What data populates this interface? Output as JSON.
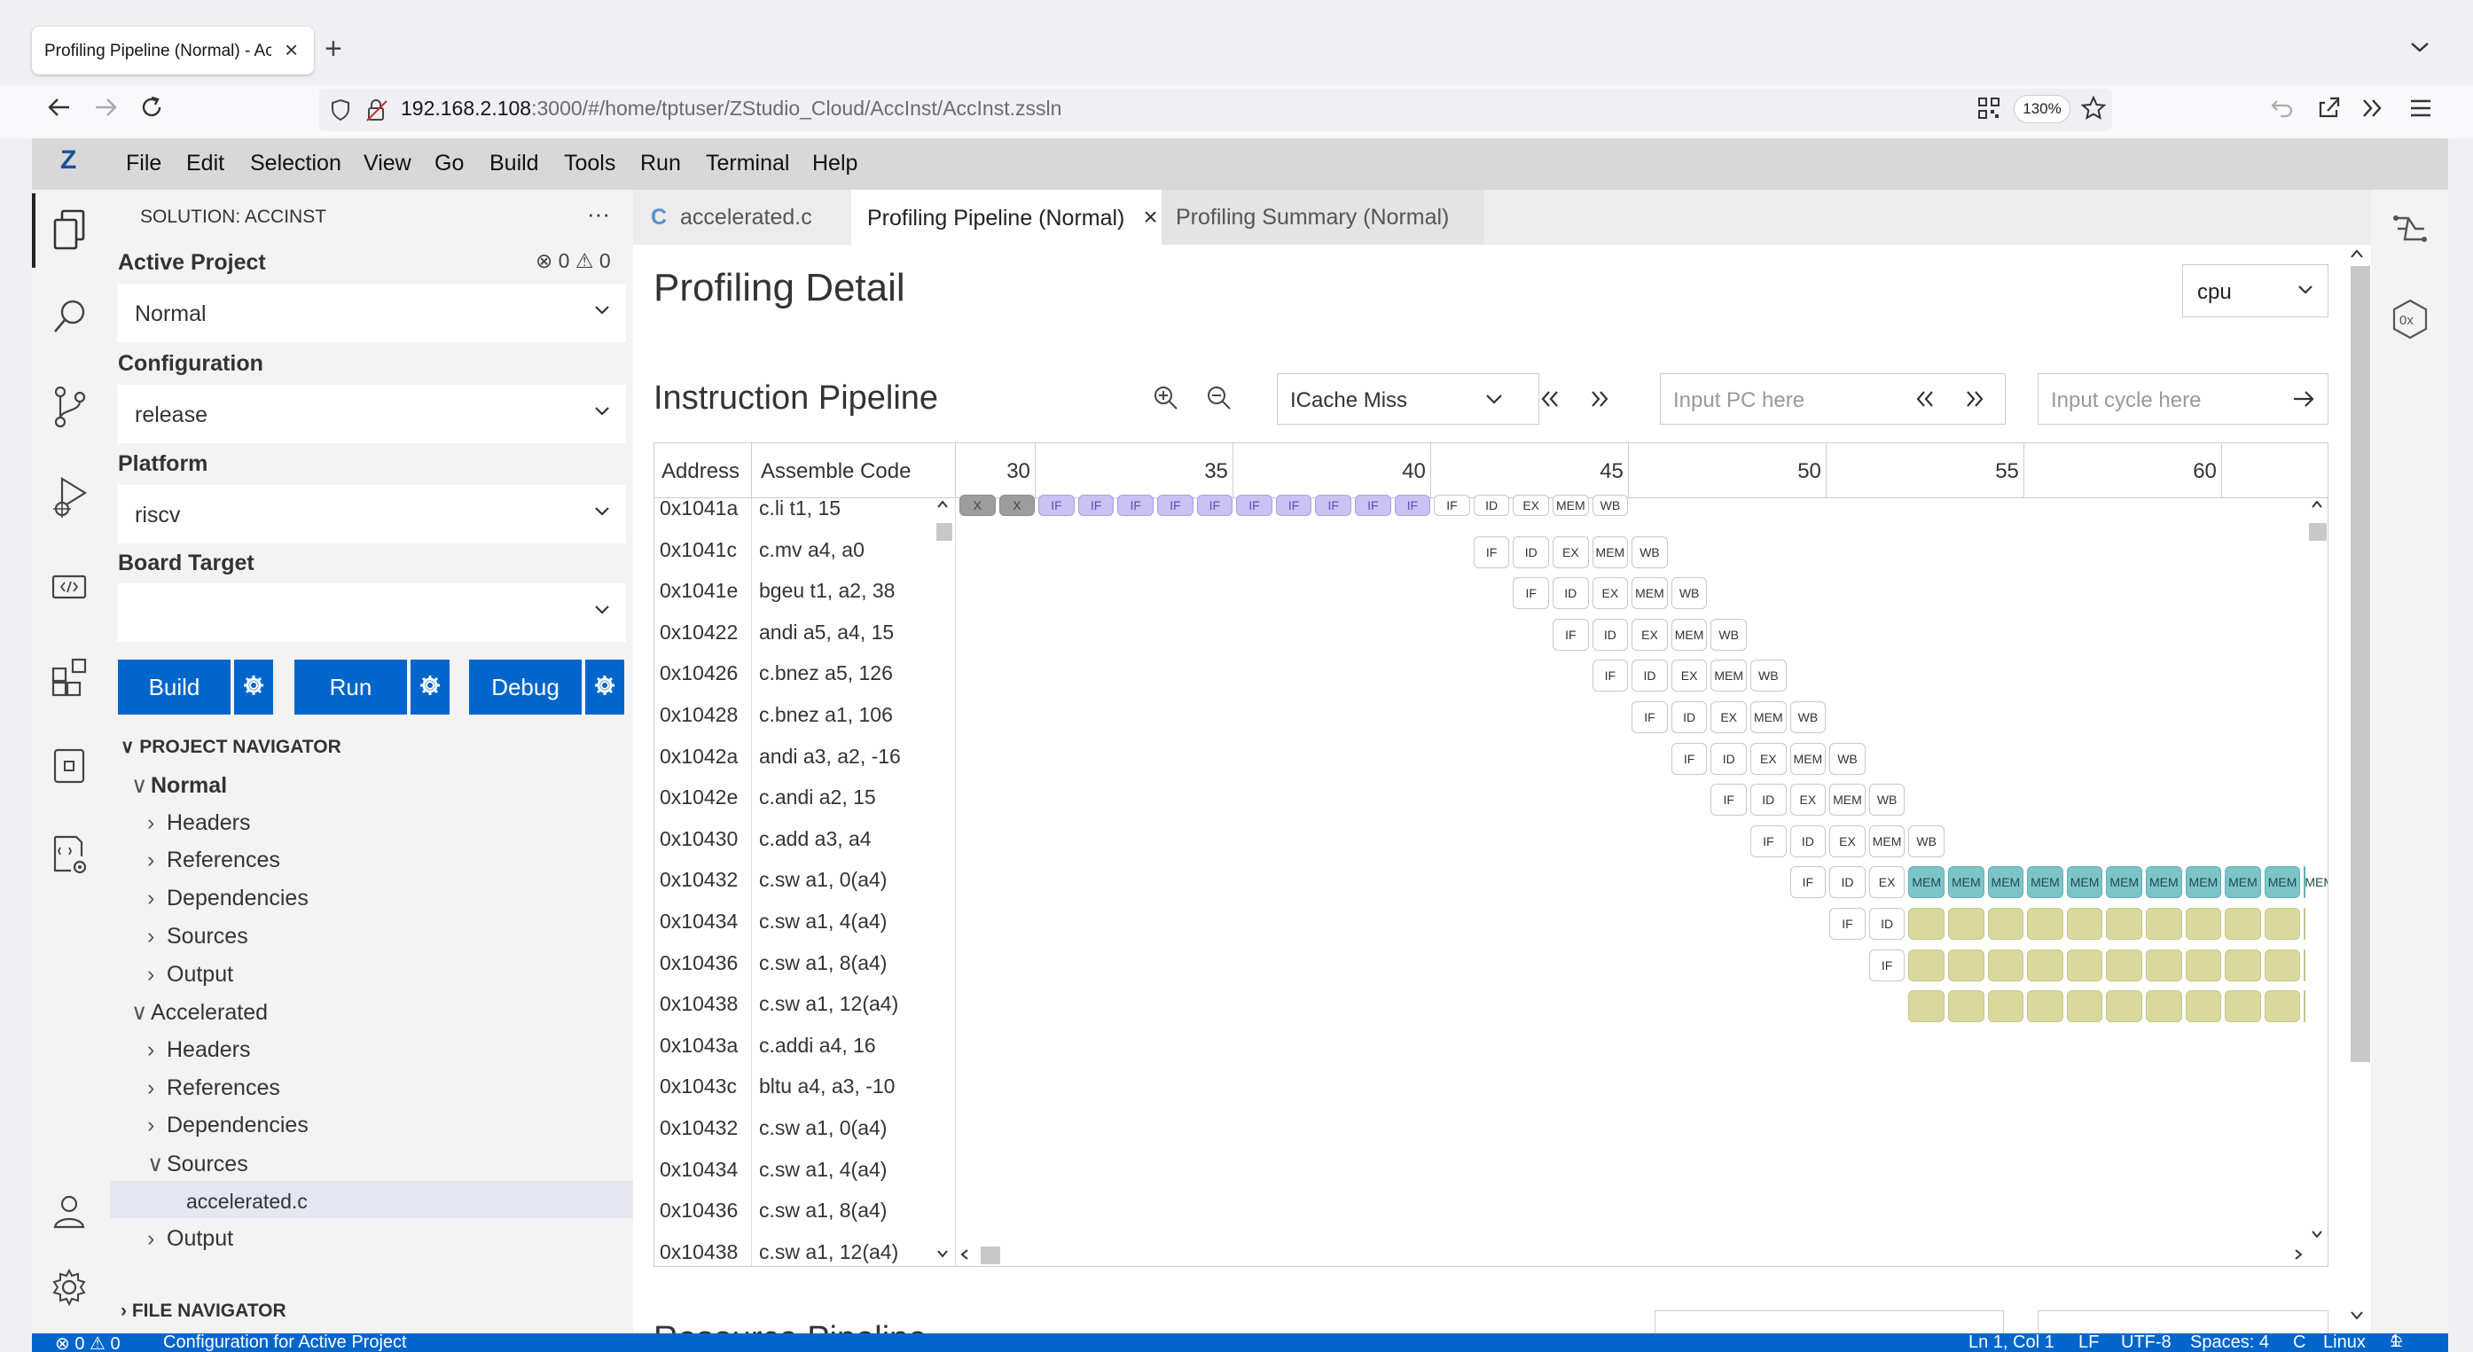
{
  "browser": {
    "tab_title": "Profiling Pipeline (Normal) - AccInst",
    "url_host": "192.168.2.108",
    "url_path": ":3000/#/home/tptuser/ZStudio_Cloud/AccInst/AccInst.zssln",
    "zoom": "130%"
  },
  "app": {
    "logo": "Z",
    "menu": [
      "File",
      "Edit",
      "Selection",
      "View",
      "Go",
      "Build",
      "Tools",
      "Run",
      "Terminal",
      "Help"
    ]
  },
  "sidebar": {
    "solution_title": "SOLUTION: ACCINST",
    "more": "···",
    "active_project_label": "Active Project",
    "problems_errors": "0",
    "problems_warnings": "0",
    "active_project_value": "Normal",
    "configuration_label": "Configuration",
    "configuration_value": "release",
    "platform_label": "Platform",
    "platform_value": "riscv",
    "board_target_label": "Board Target",
    "board_target_value": "",
    "build_label": "Build",
    "run_label": "Run",
    "debug_label": "Debug",
    "project_navigator": "PROJECT NAVIGATOR",
    "file_navigator": "FILE NAVIGATOR",
    "tree": [
      {
        "label": "Normal",
        "level": 0,
        "expanded": true
      },
      {
        "label": "Headers",
        "level": 1,
        "expanded": false
      },
      {
        "label": "References",
        "level": 1,
        "expanded": false
      },
      {
        "label": "Dependencies",
        "level": 1,
        "expanded": false
      },
      {
        "label": "Sources",
        "level": 1,
        "expanded": false
      },
      {
        "label": "Output",
        "level": 1,
        "expanded": false
      },
      {
        "label": "Accelerated",
        "level": 0,
        "expanded": true
      },
      {
        "label": "Headers",
        "level": 1,
        "expanded": false
      },
      {
        "label": "References",
        "level": 1,
        "expanded": false
      },
      {
        "label": "Dependencies",
        "level": 1,
        "expanded": false
      },
      {
        "label": "Sources",
        "level": 1,
        "expanded": true
      },
      {
        "label": "accelerated.c",
        "level": 2,
        "selected": true
      },
      {
        "label": "Output",
        "level": 1,
        "expanded": false
      }
    ]
  },
  "editor": {
    "tabs": [
      {
        "label": "accelerated.c",
        "icon": "C",
        "active": false
      },
      {
        "label": "Profiling Pipeline (Normal)",
        "active": true
      },
      {
        "label": "Profiling Summary (Normal)",
        "active": false
      }
    ]
  },
  "profiling": {
    "title": "Profiling Detail",
    "cpu_select": "cpu",
    "pipeline_title": "Instruction Pipeline",
    "event_filter": "ICache Miss",
    "pc_placeholder": "Input PC here",
    "cycle_placeholder": "Input cycle here",
    "col_address": "Address",
    "col_asm": "Assemble Code",
    "cycle_ticks": [
      "30",
      "35",
      "40",
      "45",
      "50",
      "55",
      "60"
    ],
    "first_cycle": 29,
    "rows": [
      {
        "addr": "0x1041a",
        "asm": "c.li t1, 15"
      },
      {
        "addr": "0x1041c",
        "asm": "c.mv a4, a0"
      },
      {
        "addr": "0x1041e",
        "asm": "bgeu t1, a2, 38"
      },
      {
        "addr": "0x10422",
        "asm": "andi a5, a4, 15"
      },
      {
        "addr": "0x10426",
        "asm": "c.bnez a5, 126"
      },
      {
        "addr": "0x10428",
        "asm": "c.bnez a1, 106"
      },
      {
        "addr": "0x1042a",
        "asm": "andi a3, a2, -16"
      },
      {
        "addr": "0x1042e",
        "asm": "c.andi a2, 15"
      },
      {
        "addr": "0x10430",
        "asm": "c.add a3, a4"
      },
      {
        "addr": "0x10432",
        "asm": "c.sw a1, 0(a4)"
      },
      {
        "addr": "0x10434",
        "asm": "c.sw a1, 4(a4)"
      },
      {
        "addr": "0x10436",
        "asm": "c.sw a1, 8(a4)"
      },
      {
        "addr": "0x10438",
        "asm": "c.sw a1, 12(a4)"
      },
      {
        "addr": "0x1043a",
        "asm": "c.addi a4, 16"
      },
      {
        "addr": "0x1043c",
        "asm": "bltu a4, a3, -10"
      },
      {
        "addr": "0x10432",
        "asm": "c.sw a1, 0(a4)"
      },
      {
        "addr": "0x10434",
        "asm": "c.sw a1, 4(a4)"
      },
      {
        "addr": "0x10436",
        "asm": "c.sw a1, 8(a4)"
      },
      {
        "addr": "0x10438",
        "asm": "c.sw a1, 12(a4)"
      }
    ],
    "pipeline": [
      {
        "row": 0,
        "stages": [
          "X",
          "X",
          "IF",
          "IF",
          "IF",
          "IF",
          "IF",
          "IF",
          "IF",
          "IF",
          "IF",
          "IF",
          "IF",
          "ID",
          "EX",
          "MEM",
          "WB"
        ],
        "kinds": [
          "stall",
          "stall",
          "if-miss",
          "if-miss",
          "if-miss",
          "if-miss",
          "if-miss",
          "if-miss",
          "if-miss",
          "if-miss",
          "if-miss",
          "if-miss",
          "normal",
          "normal",
          "normal",
          "normal",
          "normal"
        ],
        "start": 29
      },
      {
        "row": 1,
        "stages": [
          "IF",
          "ID",
          "EX",
          "MEM",
          "WB"
        ],
        "start": 42
      },
      {
        "row": 2,
        "stages": [
          "IF",
          "ID",
          "EX",
          "MEM",
          "WB"
        ],
        "start": 43
      },
      {
        "row": 3,
        "stages": [
          "IF",
          "ID",
          "EX",
          "MEM",
          "WB"
        ],
        "start": 44
      },
      {
        "row": 4,
        "stages": [
          "IF",
          "ID",
          "EX",
          "MEM",
          "WB"
        ],
        "start": 45
      },
      {
        "row": 5,
        "stages": [
          "IF",
          "ID",
          "EX",
          "MEM",
          "WB"
        ],
        "start": 46
      },
      {
        "row": 6,
        "stages": [
          "IF",
          "ID",
          "EX",
          "MEM",
          "WB"
        ],
        "start": 47
      },
      {
        "row": 7,
        "stages": [
          "IF",
          "ID",
          "EX",
          "MEM",
          "WB"
        ],
        "start": 48
      },
      {
        "row": 8,
        "stages": [
          "IF",
          "ID",
          "EX",
          "MEM",
          "WB"
        ],
        "start": 49
      },
      {
        "row": 9,
        "stages": [
          "IF",
          "ID",
          "EX",
          "MEM",
          "MEM",
          "MEM",
          "MEM",
          "MEM",
          "MEM",
          "MEM",
          "MEM",
          "MEM",
          "MEM",
          "MEM"
        ],
        "kinds": [
          "normal",
          "normal",
          "normal",
          "mem-long",
          "mem-long",
          "mem-long",
          "mem-long",
          "mem-long",
          "mem-long",
          "mem-long",
          "mem-long",
          "mem-long",
          "mem-long",
          "mem-long"
        ],
        "start": 50
      },
      {
        "row": 10,
        "stages": [
          "IF",
          "ID",
          "",
          "",
          "",
          "",
          "",
          "",
          "",
          "",
          "",
          "",
          ""
        ],
        "kinds": [
          "normal",
          "normal",
          "wait",
          "wait",
          "wait",
          "wait",
          "wait",
          "wait",
          "wait",
          "wait",
          "wait",
          "wait",
          "wait"
        ],
        "start": 51
      },
      {
        "row": 11,
        "stages": [
          "IF",
          "",
          "",
          "",
          "",
          "",
          "",
          "",
          "",
          "",
          "",
          ""
        ],
        "kinds": [
          "normal",
          "wait",
          "wait",
          "wait",
          "wait",
          "wait",
          "wait",
          "wait",
          "wait",
          "wait",
          "wait",
          "wait"
        ],
        "start": 52
      },
      {
        "row": 12,
        "stages": [
          "",
          "",
          "",
          "",
          "",
          "",
          "",
          "",
          "",
          "",
          ""
        ],
        "kinds": [
          "wait",
          "wait",
          "wait",
          "wait",
          "wait",
          "wait",
          "wait",
          "wait",
          "wait",
          "wait",
          "wait"
        ],
        "start": 53
      }
    ],
    "next_section_title": "Resource Pipeline"
  },
  "statusbar": {
    "problems": "⊗ 0 ⚠ 0",
    "message": "Configuration for Active Project",
    "position": "Ln 1, Col 1",
    "eol": "LF",
    "encoding": "UTF-8",
    "spaces": "Spaces: 4",
    "language": "C",
    "os": "Linux",
    "notifications": "1"
  },
  "colors": {
    "accent": "#0066cc",
    "if_miss": "#c9c2f2",
    "stall": "#9d9d9d",
    "mem_long": "#7dc4c8",
    "wait": "#d9d99e"
  }
}
